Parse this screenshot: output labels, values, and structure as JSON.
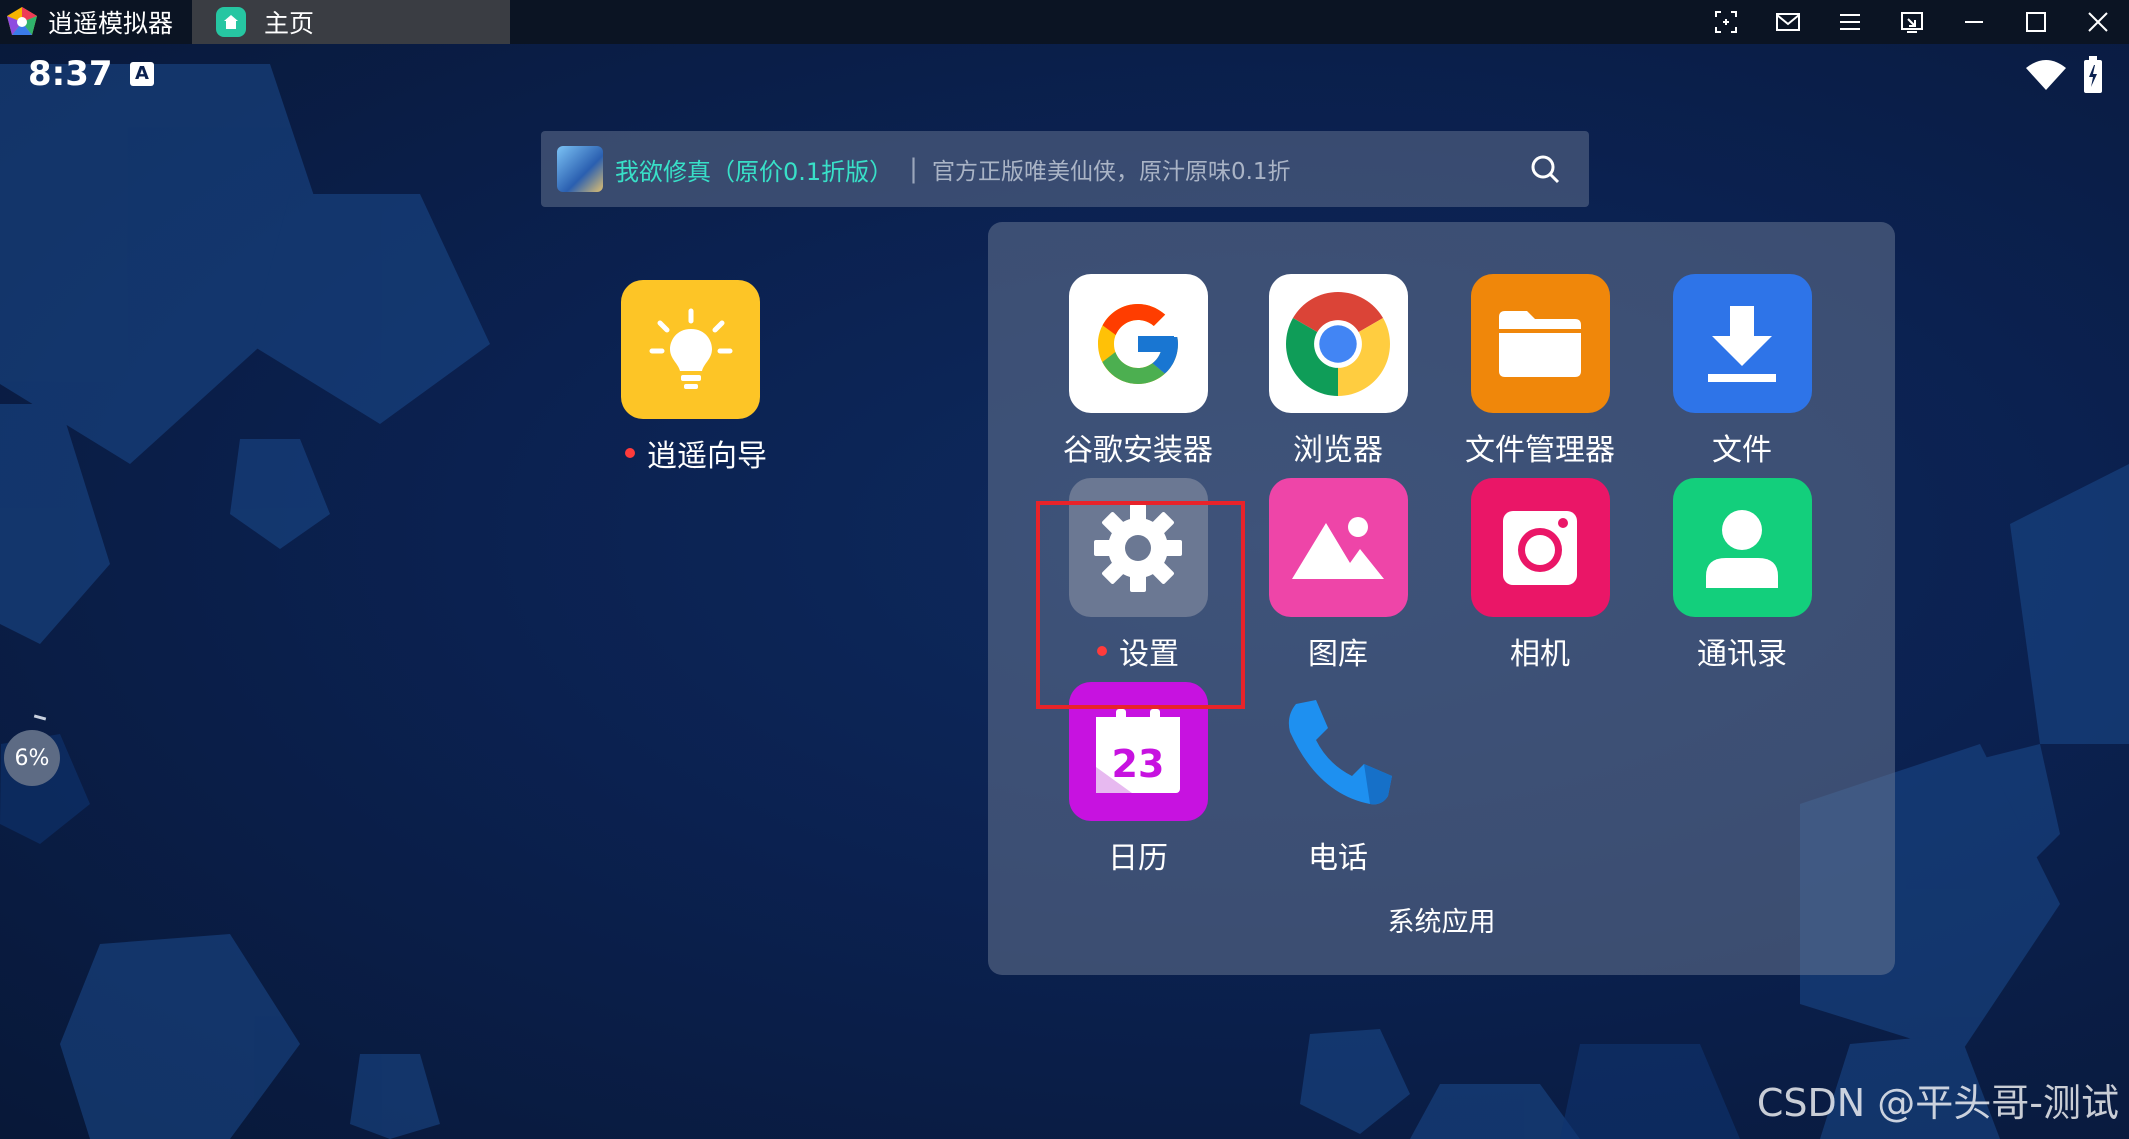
{
  "titlebar": {
    "app_name": "逍遥模拟器",
    "tab_home": "主页",
    "controls": [
      "screenshot-region-icon",
      "mail-icon",
      "menu-icon",
      "window-sync-icon",
      "minimize-icon",
      "maximize-icon",
      "close-icon"
    ]
  },
  "status": {
    "time": "8:37",
    "indicator": "A"
  },
  "search": {
    "promo": "我欲修真（原价0.1折版）",
    "separator": "|",
    "hint": "官方正版唯美仙侠，原汁原味0.1折"
  },
  "desktop_app": {
    "label": "逍遥向导",
    "icon": "lightbulb-icon",
    "color": "#fdc526"
  },
  "folder": {
    "title": "系统应用",
    "apps": [
      {
        "label": "谷歌安装器",
        "icon": "google-icon",
        "color": "#ffffff"
      },
      {
        "label": "浏览器",
        "icon": "chrome-icon",
        "color": "#ffffff"
      },
      {
        "label": "文件管理器",
        "icon": "folder-icon",
        "color": "#f0870a"
      },
      {
        "label": "文件",
        "icon": "download-icon",
        "color": "#2e74e8"
      },
      {
        "label": "设置",
        "icon": "gear-icon",
        "color": "#6b7893"
      },
      {
        "label": "图库",
        "icon": "gallery-icon",
        "color": "#ee45a8"
      },
      {
        "label": "相机",
        "icon": "camera-icon",
        "color": "#ea1667"
      },
      {
        "label": "通讯录",
        "icon": "contact-icon",
        "color": "#13cf7c"
      },
      {
        "label": "日历",
        "icon": "calendar-icon",
        "color": "#c712e0"
      },
      {
        "label": "电话",
        "icon": "phone-icon",
        "color": "#1e90f0"
      }
    ],
    "calendar_day": "23"
  },
  "side_indicator": "6%",
  "watermark": "CSDN @平头哥-测试"
}
